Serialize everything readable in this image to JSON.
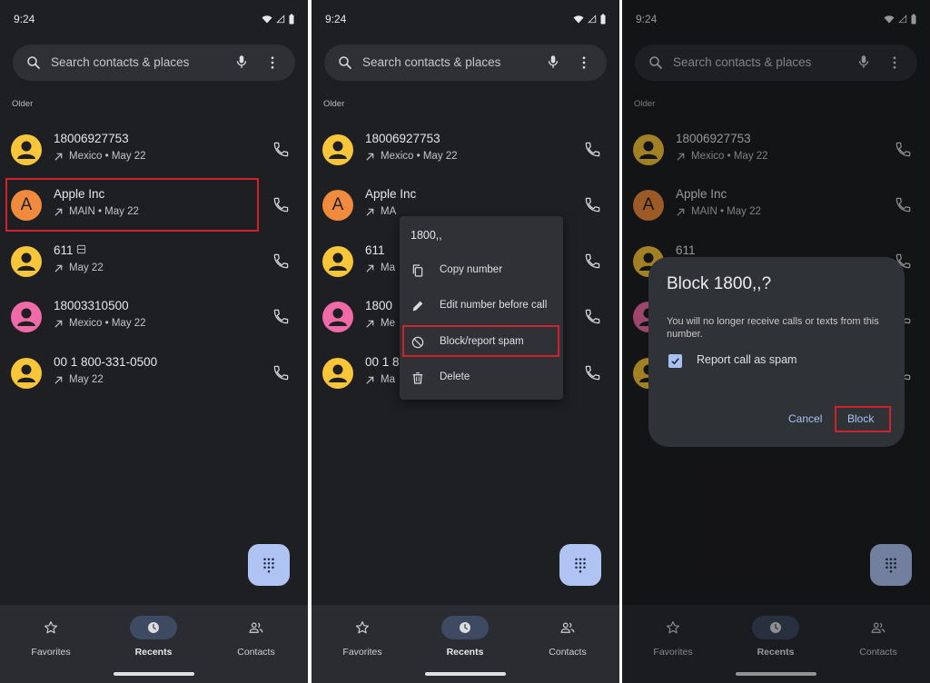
{
  "status_time": "9:24",
  "search_placeholder": "Search contacts & places",
  "section_label": "Older",
  "calls": [
    {
      "name": "18006927753",
      "detail": "Mexico • May 22",
      "avatar": "person",
      "color": "#f9c63a"
    },
    {
      "name": "Apple Inc",
      "detail": "MAIN • May 22",
      "avatar": "A",
      "color": "#f08a3c"
    },
    {
      "name": "611",
      "detail": "May 22",
      "avatar": "person",
      "color": "#f9c63a",
      "sim_badge": true
    },
    {
      "name": "18003310500",
      "detail": "Mexico • May 22",
      "avatar": "person",
      "color": "#f06aa8"
    },
    {
      "name": "00 1 800-331-0500",
      "detail": "May 22",
      "avatar": "person",
      "color": "#f9c63a"
    }
  ],
  "truncated": {
    "apple_detail": "MA",
    "short_name_2": "611",
    "short_name_3": "1800",
    "short_detail_3": "Me",
    "short_name_4": "00 1 8",
    "short_detail_4": "Ma",
    "short_detail_2": "Ma"
  },
  "nav": [
    {
      "label": "Favorites",
      "icon": "star-icon"
    },
    {
      "label": "Recents",
      "icon": "clock-icon",
      "active": true
    },
    {
      "label": "Contacts",
      "icon": "people-icon"
    }
  ],
  "context_menu": {
    "title": "1800,,",
    "items": [
      {
        "label": "Copy number",
        "icon": "copy-icon"
      },
      {
        "label": "Edit number before call",
        "icon": "pencil-icon"
      },
      {
        "label": "Block/report spam",
        "icon": "block-icon"
      },
      {
        "label": "Delete",
        "icon": "trash-icon"
      }
    ]
  },
  "dialog": {
    "title": "Block 1800,,?",
    "message": "You will no longer receive calls or texts from this number.",
    "checkbox_label": "Report call as spam",
    "checkbox_checked": true,
    "cancel_label": "Cancel",
    "block_label": "Block"
  },
  "colors": {
    "background": "#1e1f23",
    "accent": "#a9c3f4",
    "highlight": "#d1212a",
    "fab": "#b0c4f3"
  }
}
